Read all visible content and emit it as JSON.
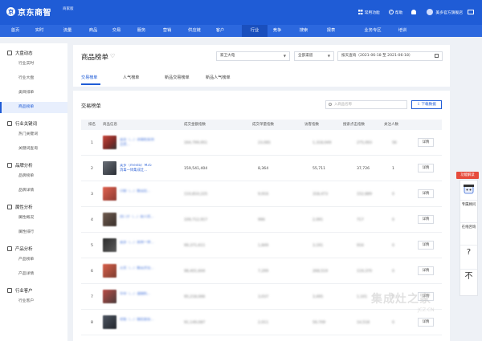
{
  "app": {
    "logo_text": "京东商智",
    "logo_badge": "商家版"
  },
  "top_right": {
    "common_functions": "常用功能",
    "help": "帮助",
    "store_name": "美多官方旗舰店"
  },
  "main_nav": [
    "首页",
    "实时",
    "流量",
    "商品",
    "交易",
    "服务",
    "营销",
    "供应链",
    "客户",
    "行业",
    "竞争",
    "搜索",
    "报表",
    "业务专区",
    "培训"
  ],
  "main_nav_active": "行业",
  "sidebar": {
    "groups": [
      {
        "label": "大盘动态",
        "items": [
          "行业实时",
          "行业大盘",
          "类目排单",
          "商品榜单"
        ]
      },
      {
        "label": "行业关键词",
        "items": [
          "热门关键词",
          "关键词查询"
        ]
      },
      {
        "label": "品牌分析",
        "items": [
          "品牌榜单",
          "品牌详情"
        ]
      },
      {
        "label": "属性分析",
        "items": [
          "属性概况",
          "属性排行"
        ]
      },
      {
        "label": "产品分析",
        "items": [
          "产品榜单",
          "产品详情"
        ]
      },
      {
        "label": "行业客户",
        "items": [
          "行业客户"
        ]
      }
    ],
    "active_item": "商品榜单"
  },
  "header": {
    "title": "商品榜单",
    "category_select": "家卫大电",
    "channel_select": "全部渠道",
    "date_range": "按天查询（2021-06-18 至 2021-06-18）",
    "tabs": [
      "交易榜单",
      "人气榜单",
      "新品交易榜单",
      "新品人气榜单"
    ],
    "active_tab": "交易榜单"
  },
  "card": {
    "title": "交易榜单",
    "search_placeholder": "入商品名称",
    "download_label": "下载数据",
    "columns": [
      "排名",
      "商品信息",
      "成交金额指数",
      "成交单量指数",
      "访客指数",
      "搜索点击指数",
      "关注人数"
    ],
    "detail_label": "详情",
    "rows": [
      {
        "rank": "1",
        "name": "美多（...）消毒柜家用立式...",
        "amount": "164,799,951",
        "orders": "23,081",
        "visitors": "1,318,049",
        "search": "275,093",
        "follows": "56"
      },
      {
        "rank": "2",
        "name": "美多（meida）M35 消毒一体集成灶...",
        "amount": "159,541,404",
        "orders": "8,364",
        "visitors": "55,711",
        "search": "37,726",
        "follows": "1"
      },
      {
        "rank": "3",
        "name": "小厨（...）集成灶...",
        "amount": "110,810,225",
        "orders": "9,916",
        "visitors": "318,473",
        "search": "152,889",
        "follows": "0"
      },
      {
        "rank": "4",
        "name": "西门子（...）嵌入式...",
        "amount": "109,712,917",
        "orders": "996",
        "visitors": "2,091",
        "search": "717",
        "follows": "0"
      },
      {
        "rank": "5",
        "name": "美多（...）蒸烤一体...",
        "amount": "99,371,611",
        "orders": "1,849",
        "visitors": "3,191",
        "search": "916",
        "follows": "0"
      },
      {
        "rank": "6",
        "name": "方太（...）集成烹饪...",
        "amount": "98,401,604",
        "orders": "7,299",
        "visitors": "268,519",
        "search": "119,370",
        "follows": "0"
      },
      {
        "rank": "7",
        "name": "华帝（...）油烟机...",
        "amount": "95,218,066",
        "orders": "3,037",
        "visitors": "3,495",
        "search": "1,101",
        "follows": "0"
      },
      {
        "rank": "8",
        "name": "老板（...）烟灶套装...",
        "amount": "91,149,087",
        "orders": "2,011",
        "visitors": "59,709",
        "search": "14,518",
        "follows": "0"
      }
    ]
  },
  "float_panel": {
    "tag": "功能解读",
    "items": [
      "专属顾问",
      "在线咨询",
      "?",
      "不"
    ]
  },
  "watermark": {
    "text": "集成灶之家",
    "sub": "JCZ.CN"
  }
}
